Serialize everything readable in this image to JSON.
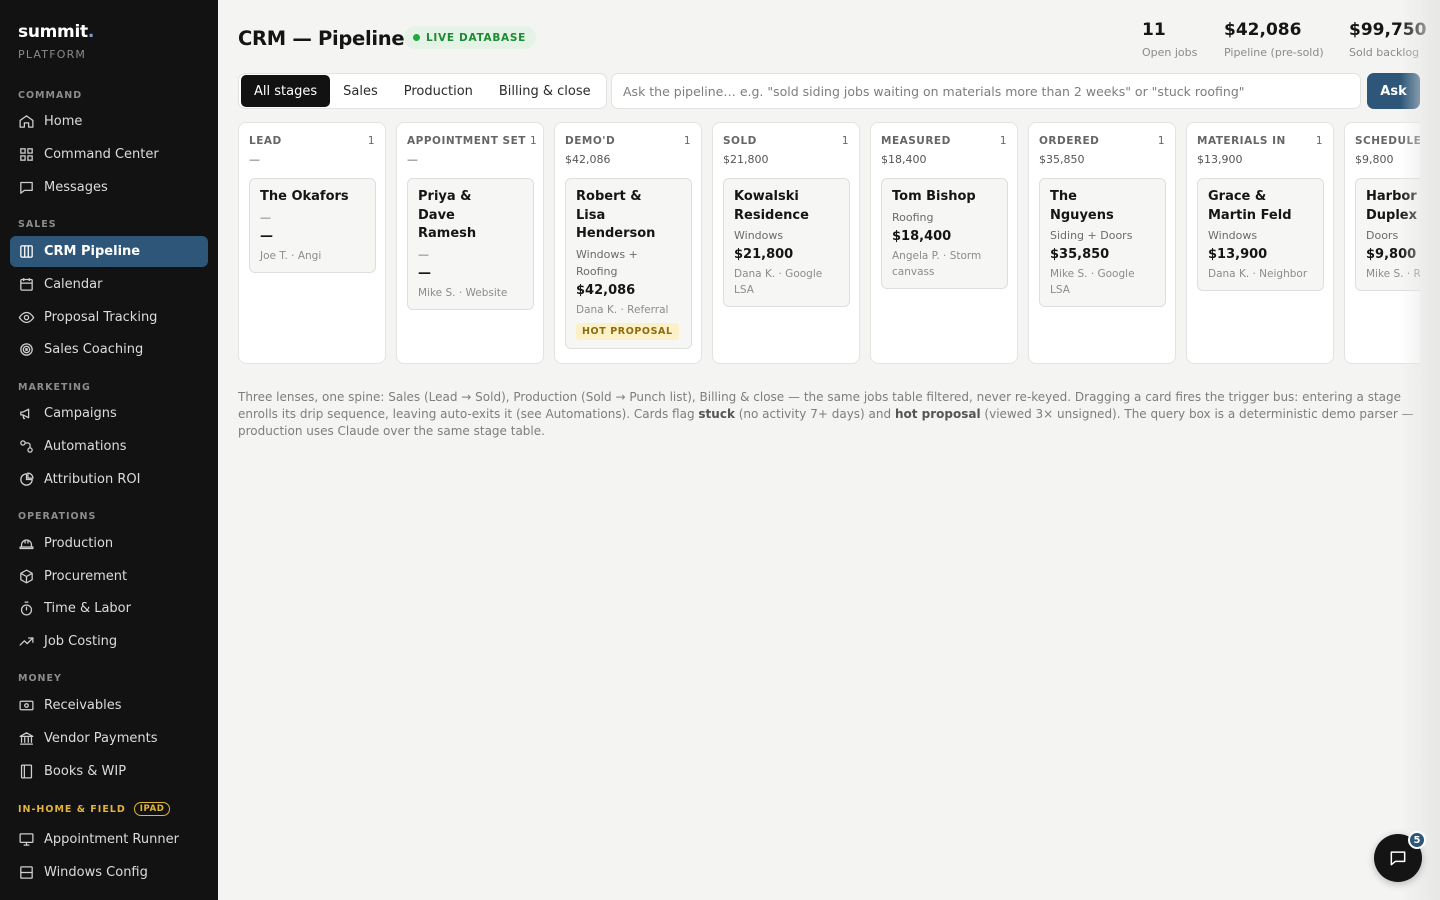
{
  "brand": {
    "name": "summit",
    "dot": ".",
    "sub": "PLATFORM"
  },
  "sidebar": {
    "sections": [
      {
        "label": "COMMAND"
      },
      {
        "label": "SALES"
      },
      {
        "label": "MARKETING"
      },
      {
        "label": "OPERATIONS"
      },
      {
        "label": "MONEY"
      },
      {
        "label": "IN-HOME & FIELD",
        "badge": "IPAD"
      }
    ],
    "items": [
      {
        "label": "Home",
        "icon": "home-icon"
      },
      {
        "label": "Command Center",
        "icon": "grid-icon"
      },
      {
        "label": "Messages",
        "icon": "message-icon"
      },
      {
        "label": "CRM Pipeline",
        "icon": "columns-icon",
        "active": true
      },
      {
        "label": "Calendar",
        "icon": "calendar-icon"
      },
      {
        "label": "Proposal Tracking",
        "icon": "eye-icon"
      },
      {
        "label": "Sales Coaching",
        "icon": "target-icon"
      },
      {
        "label": "Campaigns",
        "icon": "megaphone-icon"
      },
      {
        "label": "Automations",
        "icon": "workflow-icon"
      },
      {
        "label": "Attribution ROI",
        "icon": "pie-icon"
      },
      {
        "label": "Production",
        "icon": "hardhat-icon"
      },
      {
        "label": "Procurement",
        "icon": "box-icon"
      },
      {
        "label": "Time & Labor",
        "icon": "stopwatch-icon"
      },
      {
        "label": "Job Costing",
        "icon": "trend-icon"
      },
      {
        "label": "Receivables",
        "icon": "banknote-icon"
      },
      {
        "label": "Vendor Payments",
        "icon": "bank-icon"
      },
      {
        "label": "Books & WIP",
        "icon": "book-icon"
      },
      {
        "label": "Appointment Runner",
        "icon": "presentation-icon"
      },
      {
        "label": "Windows Config",
        "icon": "window-icon"
      }
    ]
  },
  "header": {
    "title": "CRM — Pipeline",
    "live_label": "LIVE DATABASE",
    "kpis": [
      {
        "value": "11",
        "label": "Open jobs"
      },
      {
        "value": "$42,086",
        "label": "Pipeline (pre-sold)"
      },
      {
        "value": "$99,750",
        "label": "Sold backlog"
      }
    ]
  },
  "tabs": [
    {
      "label": "All stages",
      "active": true
    },
    {
      "label": "Sales"
    },
    {
      "label": "Production"
    },
    {
      "label": "Billing & close"
    }
  ],
  "query": {
    "placeholder": "Ask the pipeline… e.g. \"sold siding jobs waiting on materials more than 2 weeks\" or \"stuck roofing\"",
    "value": "",
    "button": "Ask"
  },
  "stages": [
    {
      "name": "LEAD",
      "count": "1",
      "total": "—",
      "card": {
        "name": "The Okafors",
        "type": "—",
        "amount": "—",
        "meta": "Joe T. · Angi"
      }
    },
    {
      "name": "APPOINTMENT SET",
      "count": "1",
      "total": "—",
      "card": {
        "name": "Priya & Dave Ramesh",
        "type": "—",
        "amount": "—",
        "meta": "Mike S. · Website"
      }
    },
    {
      "name": "DEMO'D",
      "count": "1",
      "total": "$42,086",
      "card": {
        "name": "Robert & Lisa Henderson",
        "type": "Windows + Roofing",
        "amount": "$42,086",
        "meta": "Dana K. · Referral",
        "badge": "HOT PROPOSAL"
      }
    },
    {
      "name": "SOLD",
      "count": "1",
      "total": "$21,800",
      "card": {
        "name": "Kowalski Residence",
        "type": "Windows",
        "amount": "$21,800",
        "meta": "Dana K. · Google LSA"
      }
    },
    {
      "name": "MEASURED",
      "count": "1",
      "total": "$18,400",
      "card": {
        "name": "Tom Bishop",
        "type": "Roofing",
        "amount": "$18,400",
        "meta": "Angela P. · Storm canvass"
      }
    },
    {
      "name": "ORDERED",
      "count": "1",
      "total": "$35,850",
      "card": {
        "name": "The Nguyens",
        "type": "Siding + Doors",
        "amount": "$35,850",
        "meta": "Mike S. · Google LSA"
      }
    },
    {
      "name": "MATERIALS IN",
      "count": "1",
      "total": "$13,900",
      "card": {
        "name": "Grace & Martin Feld",
        "type": "Windows",
        "amount": "$13,900",
        "meta": "Dana K. · Neighbor"
      }
    },
    {
      "name": "SCHEDULE",
      "count": "",
      "total": "$9,800",
      "card": {
        "name": "Harbor Duplex",
        "type": "Doors",
        "amount": "$9,800",
        "meta": "Mike S. · R"
      }
    }
  ],
  "footnote": {
    "part1": "Three lenses, one spine: Sales (Lead → Sold), Production (Sold → Punch list), Billing & close — the same jobs table filtered, never re-keyed. Dragging a card fires the trigger bus: entering a stage enrolls its drip sequence, leaving auto-exits it (see Automations). Cards flag ",
    "stuck": "stuck",
    "part2": " (no activity 7+ days) and ",
    "hot": "hot proposal",
    "part3": " (viewed 3× unsigned). The query box is a deterministic demo parser — production uses Claude over the same stage table."
  },
  "chat": {
    "badge": "5"
  },
  "colors": {
    "accent": "#2d5678",
    "sidebar_bg": "#121212",
    "live_green": "#1fa83f",
    "warning": "#e2b43c"
  }
}
